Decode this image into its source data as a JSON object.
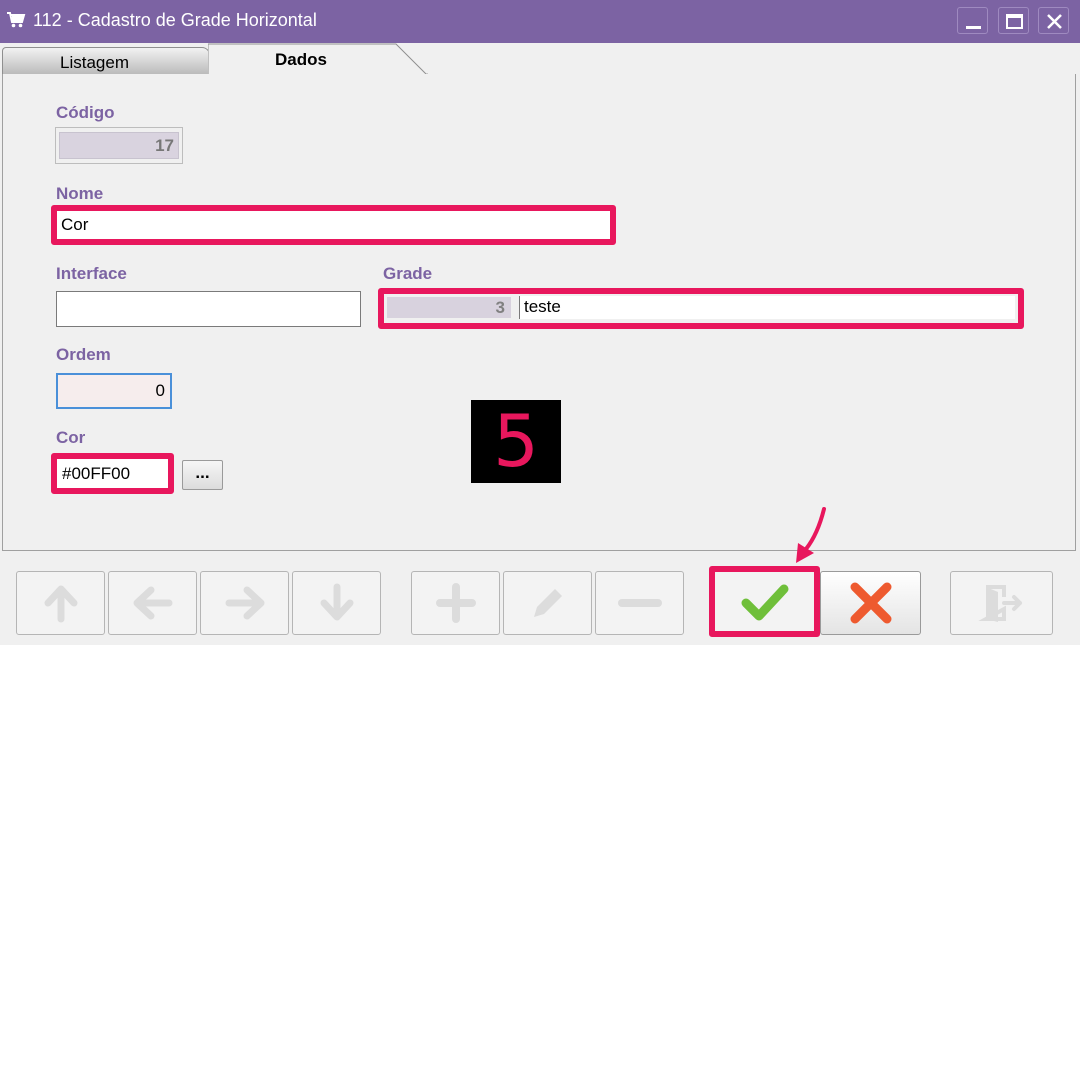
{
  "window": {
    "title": "112 - Cadastro de Grade Horizontal",
    "accent_color": "#7c63a3",
    "icon": "shopping-cart-icon"
  },
  "tabs": [
    {
      "label": "Listagem",
      "active": false
    },
    {
      "label": "Dados",
      "active": true
    }
  ],
  "form": {
    "codigo": {
      "label": "Código",
      "value": "17"
    },
    "nome": {
      "label": "Nome",
      "value": "Cor"
    },
    "interface": {
      "label": "Interface",
      "value": ""
    },
    "grade": {
      "label": "Grade",
      "id_value": "3",
      "name_value": "teste"
    },
    "ordem": {
      "label": "Ordem",
      "value": "0"
    },
    "cor": {
      "label": "Cor",
      "value": "#00FF00",
      "picker_label": "..."
    }
  },
  "annotation": {
    "step_number": "5",
    "highlight_color": "#e8175d"
  },
  "toolbar": {
    "buttons": [
      {
        "name": "first-record",
        "icon": "arrow-up-icon",
        "enabled": false
      },
      {
        "name": "previous-record",
        "icon": "arrow-left-icon",
        "enabled": false
      },
      {
        "name": "next-record",
        "icon": "arrow-right-icon",
        "enabled": false
      },
      {
        "name": "last-record",
        "icon": "arrow-down-icon",
        "enabled": false
      },
      {
        "name": "add",
        "icon": "plus-icon",
        "enabled": false
      },
      {
        "name": "edit",
        "icon": "pencil-icon",
        "enabled": false
      },
      {
        "name": "delete",
        "icon": "minus-icon",
        "enabled": false
      },
      {
        "name": "confirm",
        "icon": "checkmark-icon",
        "enabled": true,
        "color": "#6fbf3a"
      },
      {
        "name": "cancel",
        "icon": "x-icon",
        "enabled": true,
        "color": "#ee5a2f"
      },
      {
        "name": "exit",
        "icon": "exit-door-icon",
        "enabled": false
      }
    ]
  }
}
